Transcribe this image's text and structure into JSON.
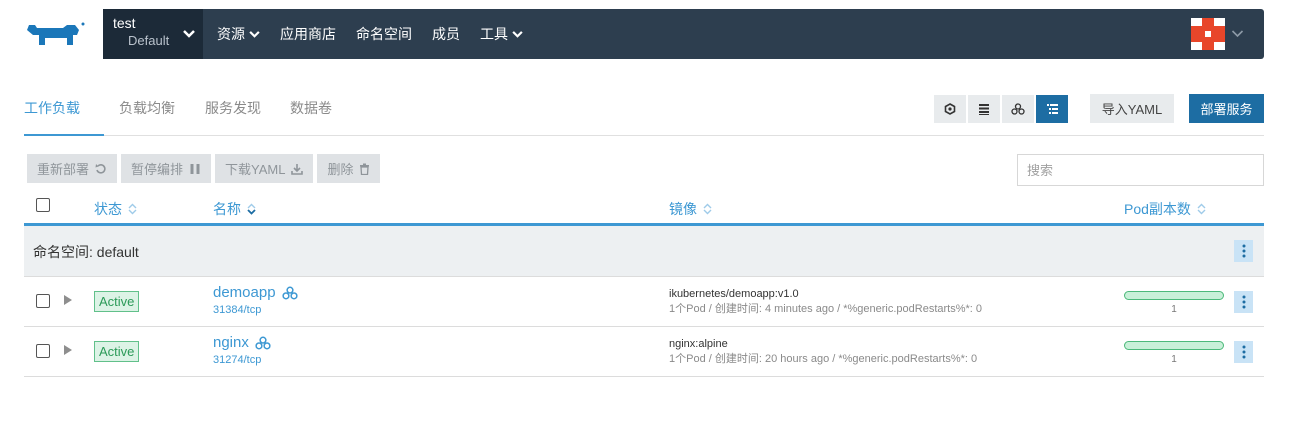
{
  "header": {
    "project": "test",
    "namespace": "Default",
    "nav": [
      "资源",
      "应用商店",
      "命名空间",
      "成员",
      "工具"
    ],
    "colors": {
      "bg": "#2d3e4f",
      "accent": "#3d98d3"
    }
  },
  "tabs": [
    "工作负载",
    "负载均衡",
    "服务发现",
    "数据卷"
  ],
  "actions": {
    "import_yaml": "导入YAML",
    "deploy": "部署服务"
  },
  "bulk_actions": [
    "重新部署",
    "暂停编排",
    "下载YAML",
    "删除"
  ],
  "search": {
    "placeholder": "搜索"
  },
  "table": {
    "columns": [
      "状态",
      "名称",
      "镜像",
      "Pod副本数"
    ],
    "group_label": "命名空间: default",
    "rows": [
      {
        "status": "Active",
        "name": "demoapp",
        "port": "31384/tcp",
        "image": "ikubernetes/demoapp:v1.0",
        "meta": "1个Pod / 创建时间: 4 minutes ago / *%generic.podRestarts%*: 0",
        "pods": "1",
        "pods_ready_fraction": 1
      },
      {
        "status": "Active",
        "name": "nginx",
        "port": "31274/tcp",
        "image": "nginx:alpine",
        "meta": "1个Pod / 创建时间: 20 hours ago / *%generic.podRestarts%*: 0",
        "pods": "1",
        "pods_ready_fraction": 1
      }
    ]
  }
}
